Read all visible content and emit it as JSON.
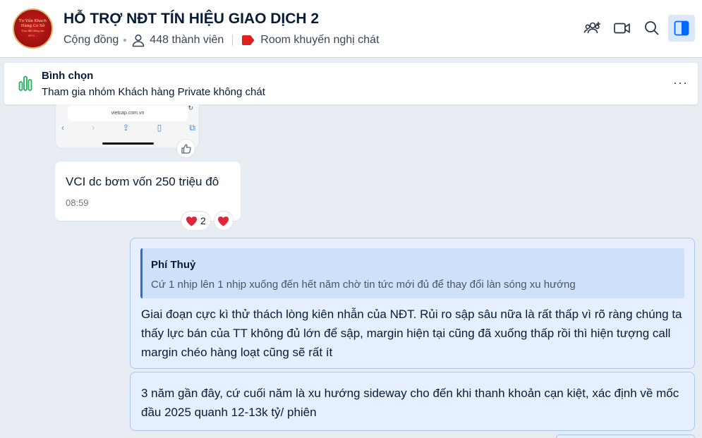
{
  "group": {
    "avatar_lines": [
      "Tư Vấn Khách",
      "Hàng Cơ Sở",
      "Trao đổi thông tin",
      "0979 ..."
    ],
    "title": "HỖ TRỢ NĐT TÍN HIỆU GIAO DỊCH 2",
    "type_label": "Cộng đồng",
    "members": "448 thành viên",
    "room_tag": "Room khuyến nghị chát",
    "tag_color": "#e02020"
  },
  "header_icons": [
    "add-member-icon",
    "video-call-icon",
    "search-icon",
    "sidebar-toggle-icon"
  ],
  "poll": {
    "title": "Bình chọn",
    "subtitle": "Tham gia nhóm Khách hàng Private không chát",
    "more": "···"
  },
  "screenshot_fragment": {
    "url": "vietcap.com.vn"
  },
  "messages": [
    {
      "text": "VCI dc bơm vốn 250 triệu đô",
      "time": "08:59",
      "reaction_count": "2"
    },
    {
      "quote_author": "Phí Thuỷ",
      "quote_text": "Cứ 1 nhịp lên 1 nhịp xuống đến hết năm chờ tin tức mới đủ để thay đổi làn sóng xu hướng",
      "text": "Giai đoạn cực kì thử thách lòng kiên nhẫn của NĐT. Rủi ro sập sâu nữa là rất thấp vì rõ ràng chúng ta thấy lực bán của TT không đủ lớn để sập, margin hiện tại cũng đã xuống thấp rồi thì hiện tượng call margin chéo hàng loạt cũng sẽ rất ít"
    },
    {
      "text": "3 năm gần đây, cứ cuối năm là xu hướng sideway cho đến khi thanh khoản cạn kiệt, xác định về mốc đầu 2025 quanh 12-13k tỷ/ phiên"
    }
  ],
  "colors": {
    "accent": "#0068ff",
    "self_bubble": "#e5efff",
    "heart": "#e0263a",
    "poll_icon": "#1fb256"
  }
}
